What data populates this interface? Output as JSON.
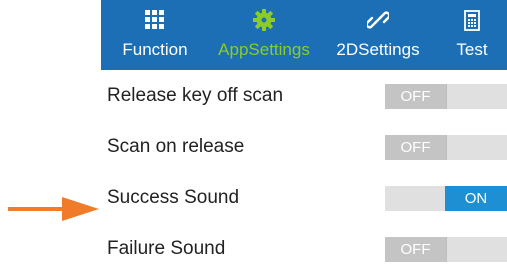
{
  "tabs": [
    {
      "label": "Function",
      "icon": "grid-icon",
      "active": false
    },
    {
      "label": "AppSettings",
      "icon": "gear-icon",
      "active": true
    },
    {
      "label": "2DSettings",
      "icon": "link-icon",
      "active": false
    },
    {
      "label": "Test",
      "icon": "calculator-icon",
      "active": false
    }
  ],
  "settings": [
    {
      "label": "Release key off scan",
      "state": "OFF"
    },
    {
      "label": "Scan on release",
      "state": "OFF"
    },
    {
      "label": "Success Sound",
      "state": "ON"
    },
    {
      "label": "Failure Sound",
      "state": "OFF"
    }
  ],
  "colors": {
    "tabbar": "#1c6fb5",
    "active_tab": "#8ccb2a",
    "switch_on": "#1f8fd3",
    "switch_off": "#c4c4c4",
    "arrow": "#f07b2a"
  }
}
